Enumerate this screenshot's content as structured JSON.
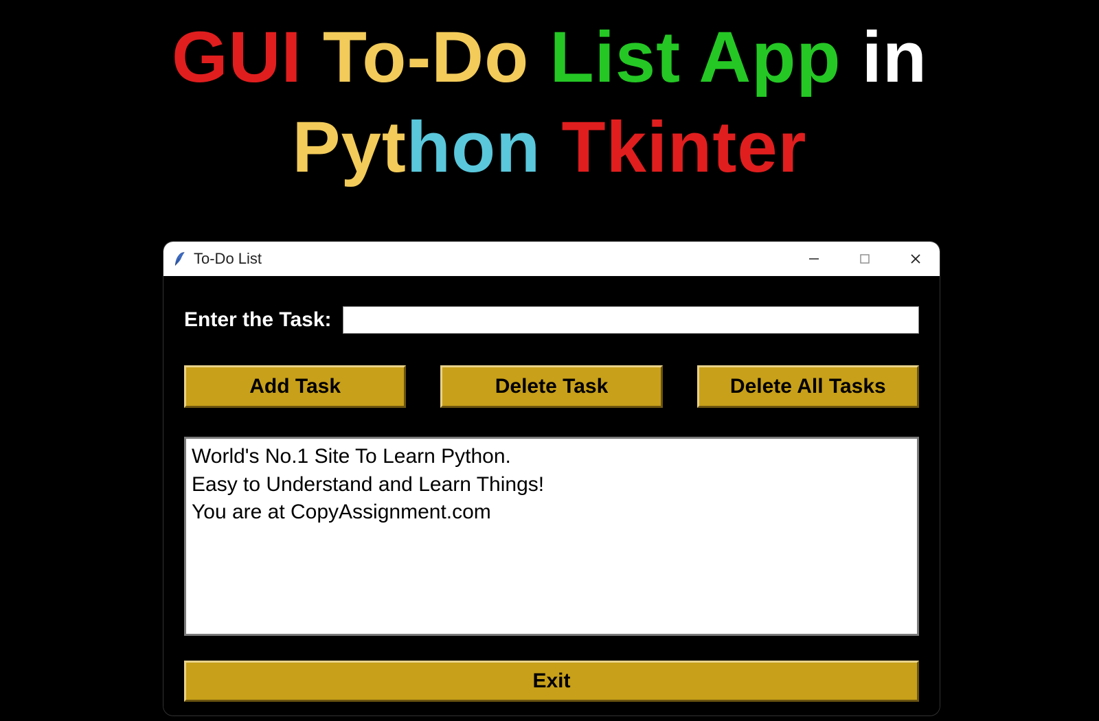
{
  "headline": {
    "w1": "GUI",
    "w2": "To-Do",
    "w3": "List",
    "w4": "App",
    "w5": "in",
    "w6a": "Pyt",
    "w6b": "hon",
    "w7": "Tkinter"
  },
  "window": {
    "title": "To-Do List"
  },
  "form": {
    "label": "Enter the Task:",
    "value": ""
  },
  "buttons": {
    "add": "Add Task",
    "delete": "Delete Task",
    "delete_all": "Delete All Tasks",
    "exit": "Exit"
  },
  "tasks": [
    "World's No.1 Site To Learn Python.",
    "Easy to Understand and Learn Things!",
    "You are at CopyAssignment.com"
  ]
}
